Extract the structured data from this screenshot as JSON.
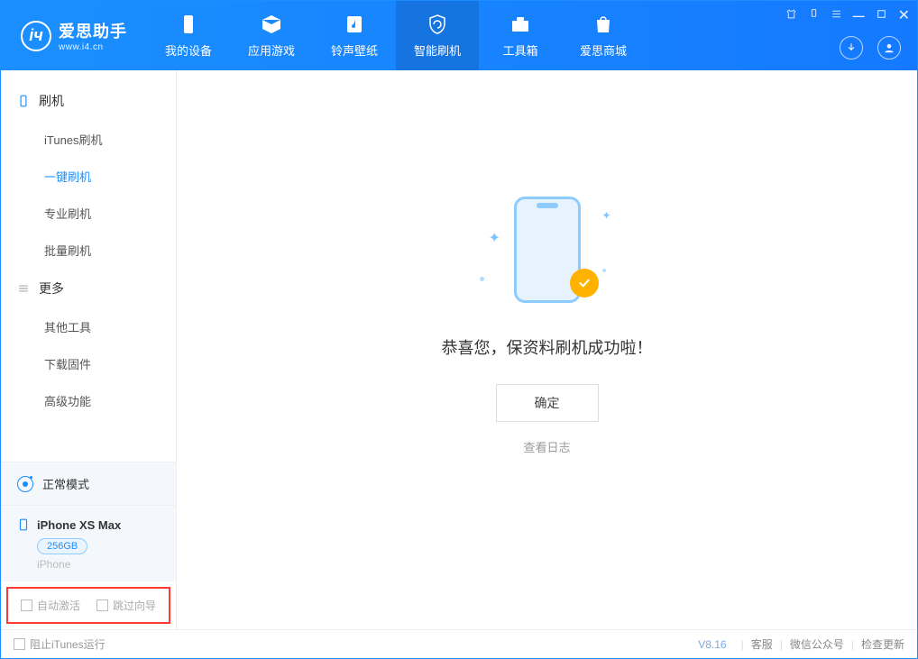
{
  "app": {
    "title": "爱思助手",
    "url": "www.i4.cn"
  },
  "nav": {
    "tabs": [
      {
        "label": "我的设备"
      },
      {
        "label": "应用游戏"
      },
      {
        "label": "铃声壁纸"
      },
      {
        "label": "智能刷机"
      },
      {
        "label": "工具箱"
      },
      {
        "label": "爱思商城"
      }
    ]
  },
  "sidebar": {
    "group1_title": "刷机",
    "group1_items": [
      "iTunes刷机",
      "一键刷机",
      "专业刷机",
      "批量刷机"
    ],
    "group2_title": "更多",
    "group2_items": [
      "其他工具",
      "下载固件",
      "高级功能"
    ]
  },
  "device": {
    "mode": "正常模式",
    "name": "iPhone XS Max",
    "storage": "256GB",
    "type": "iPhone"
  },
  "options": {
    "auto_activate": "自动激活",
    "skip_guide": "跳过向导"
  },
  "main": {
    "success_msg": "恭喜您，保资料刷机成功啦！",
    "confirm": "确定",
    "view_log": "查看日志"
  },
  "footer": {
    "block_itunes": "阻止iTunes运行",
    "version": "V8.16",
    "links": [
      "客服",
      "微信公众号",
      "检查更新"
    ]
  }
}
